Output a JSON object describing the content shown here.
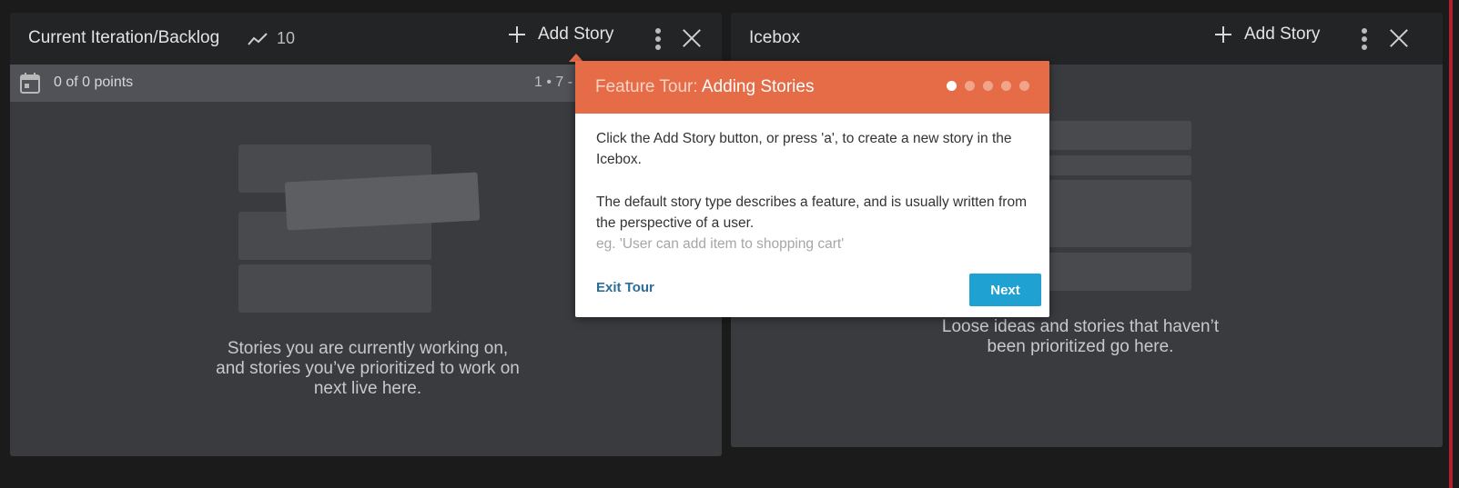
{
  "backlog": {
    "title": "Current Iteration/Backlog",
    "velocity": "10",
    "add_story": "Add Story",
    "points": "0 of 0 points",
    "iteration_range": "1 • 7 -",
    "empty_text": "Stories you are currently working on, and stories you’ve prioritized to work on next live here."
  },
  "icebox": {
    "title": "Icebox",
    "add_story": "Add Story",
    "empty_text": "Loose ideas and stories that haven’t been prioritized go here."
  },
  "tour": {
    "prefix": "Feature Tour:",
    "name": "Adding Stories",
    "steps_total": 5,
    "active_step": 1,
    "paragraph1": "Click the Add Story button, or press 'a', to create a new story in the Icebox.",
    "paragraph2": "The default story type describes a feature, and is usually written from the perspective of a user.",
    "example": "eg. 'User can add item to shopping cart'",
    "exit_label": "Exit Tour",
    "next_label": "Next"
  },
  "colors": {
    "tour_header": "#e66c48",
    "next_button": "#1fa1d2",
    "link": "#2b6e9a",
    "panel_body": "#393b3f"
  }
}
